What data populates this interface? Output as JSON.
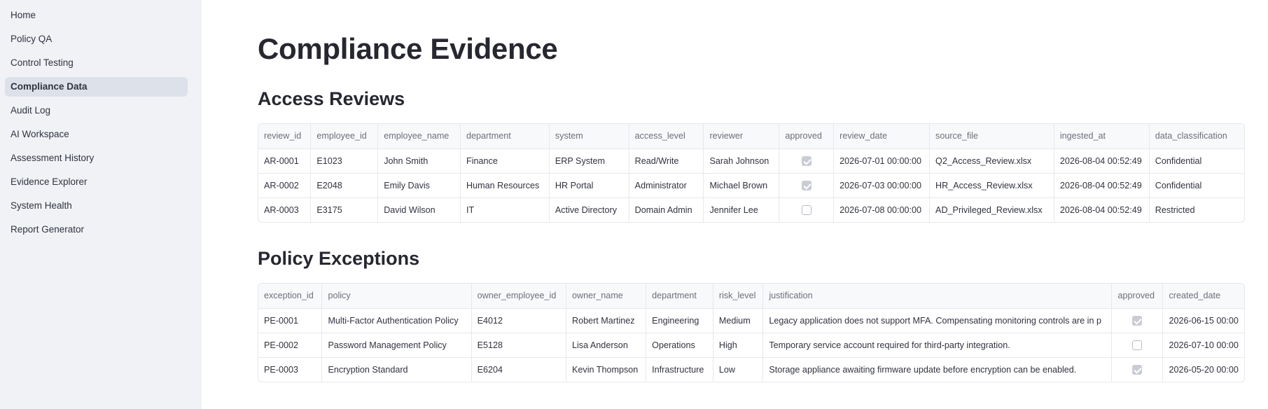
{
  "sidebar": {
    "items": [
      {
        "label": "Home"
      },
      {
        "label": "Policy QA"
      },
      {
        "label": "Control Testing"
      },
      {
        "label": "Compliance Data",
        "active": true
      },
      {
        "label": "Audit Log"
      },
      {
        "label": "AI Workspace"
      },
      {
        "label": "Assessment History"
      },
      {
        "label": "Evidence Explorer"
      },
      {
        "label": "System Health"
      },
      {
        "label": "Report Generator"
      }
    ]
  },
  "main": {
    "title": "Compliance Evidence",
    "access_reviews": {
      "title": "Access Reviews",
      "columns": [
        "review_id",
        "employee_id",
        "employee_name",
        "department",
        "system",
        "access_level",
        "reviewer",
        "approved",
        "review_date",
        "source_file",
        "ingested_at",
        "data_classification"
      ],
      "rows": [
        {
          "review_id": "AR-0001",
          "employee_id": "E1023",
          "employee_name": "John Smith",
          "department": "Finance",
          "system": "ERP System",
          "access_level": "Read/Write",
          "reviewer": "Sarah Johnson",
          "approved": true,
          "review_date": "2026-07-01 00:00:00",
          "source_file": "Q2_Access_Review.xlsx",
          "ingested_at": "2026-08-04 00:52:49",
          "data_classification": "Confidential"
        },
        {
          "review_id": "AR-0002",
          "employee_id": "E2048",
          "employee_name": "Emily Davis",
          "department": "Human Resources",
          "system": "HR Portal",
          "access_level": "Administrator",
          "reviewer": "Michael Brown",
          "approved": true,
          "review_date": "2026-07-03 00:00:00",
          "source_file": "HR_Access_Review.xlsx",
          "ingested_at": "2026-08-04 00:52:49",
          "data_classification": "Confidential"
        },
        {
          "review_id": "AR-0003",
          "employee_id": "E3175",
          "employee_name": "David Wilson",
          "department": "IT",
          "system": "Active Directory",
          "access_level": "Domain Admin",
          "reviewer": "Jennifer Lee",
          "approved": false,
          "review_date": "2026-07-08 00:00:00",
          "source_file": "AD_Privileged_Review.xlsx",
          "ingested_at": "2026-08-04 00:52:49",
          "data_classification": "Restricted"
        }
      ]
    },
    "policy_exceptions": {
      "title": "Policy Exceptions",
      "columns": [
        "exception_id",
        "policy",
        "owner_employee_id",
        "owner_name",
        "department",
        "risk_level",
        "justification",
        "approved",
        "created_date"
      ],
      "rows": [
        {
          "exception_id": "PE-0001",
          "policy": "Multi-Factor Authentication Policy",
          "owner_employee_id": "E4012",
          "owner_name": "Robert Martinez",
          "department": "Engineering",
          "risk_level": "Medium",
          "justification": "Legacy application does not support MFA. Compensating monitoring controls are in p",
          "approved": true,
          "created_date": "2026-06-15 00:00"
        },
        {
          "exception_id": "PE-0002",
          "policy": "Password Management Policy",
          "owner_employee_id": "E5128",
          "owner_name": "Lisa Anderson",
          "department": "Operations",
          "risk_level": "High",
          "justification": "Temporary service account required for third-party integration.",
          "approved": false,
          "created_date": "2026-07-10 00:00"
        },
        {
          "exception_id": "PE-0003",
          "policy": "Encryption Standard",
          "owner_employee_id": "E6204",
          "owner_name": "Kevin Thompson",
          "department": "Infrastructure",
          "risk_level": "Low",
          "justification": "Storage appliance awaiting firmware update before encryption can be enabled.",
          "approved": true,
          "created_date": "2026-05-20 00:00"
        }
      ]
    }
  }
}
